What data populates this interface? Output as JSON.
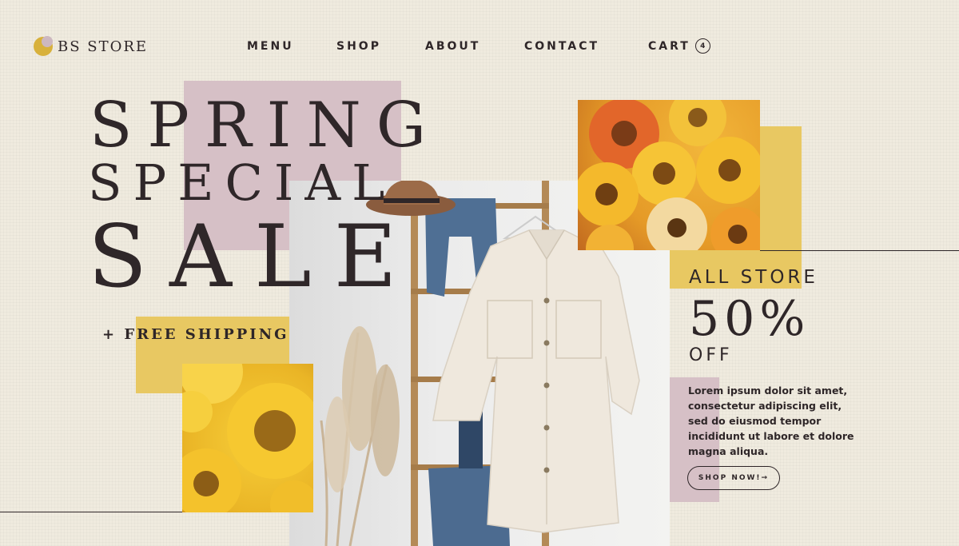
{
  "brand": {
    "name": "BS STORE"
  },
  "nav": {
    "items": [
      {
        "label": "MENU"
      },
      {
        "label": "SHOP"
      },
      {
        "label": "ABOUT"
      },
      {
        "label": "CONTACT"
      }
    ],
    "cart": {
      "label": "CART",
      "count": "4"
    }
  },
  "hero": {
    "line1": "SPRING",
    "line2": "SPECIAL",
    "line3": "SALE",
    "shipping": "+ FREE SHIPPING"
  },
  "promo": {
    "all_store": "ALL STORE",
    "percent": "50%",
    "off": "OFF",
    "description": "Lorem ipsum dolor sit amet, consectetur adipiscing elit, sed do eiusmod tempor incididunt ut labore et dolore magna aliqua.",
    "cta": "SHOP NOW!→"
  },
  "colors": {
    "background": "#f0ebdf",
    "pink": "#d6c0c6",
    "gold": "#e8c862",
    "text": "#2e2628"
  }
}
